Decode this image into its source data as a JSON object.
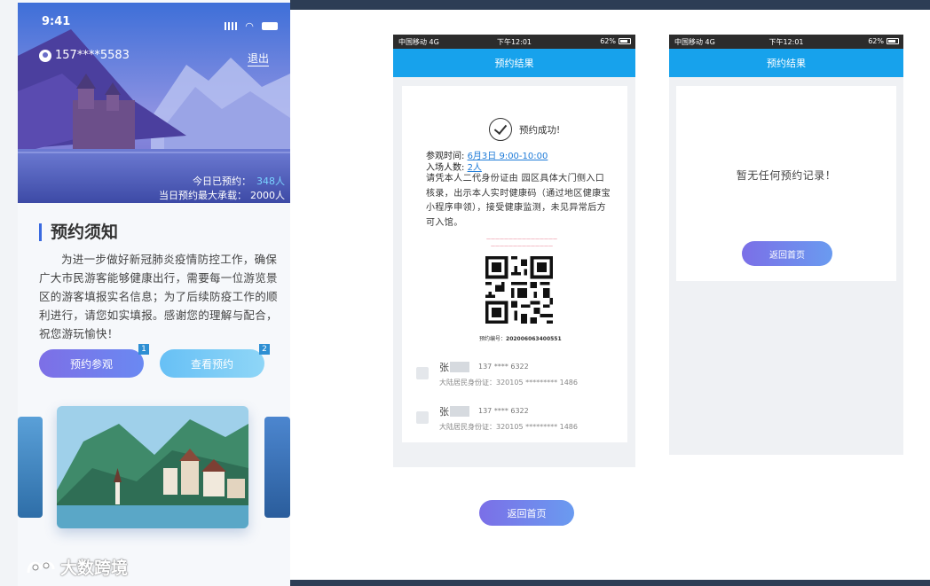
{
  "colors": {
    "accent_purple": "#7b6fe7",
    "accent_light_blue": "#67c0f5",
    "header_blue": "#17a2ec",
    "frame_dark": "#2d3d55",
    "link_blue": "#1e7bd8",
    "notice_red": "#e4566f"
  },
  "screen1": {
    "status": {
      "time": "9:41"
    },
    "user": {
      "phone": "157****5583",
      "icon": "user-icon"
    },
    "logout_label": "退出",
    "stats": {
      "today_label": "今日已预约：",
      "today_value": "348人",
      "max_label": "当日预约最大承载：",
      "max_value": "2000人"
    },
    "notice": {
      "title": "预约须知",
      "body": "为进一步做好新冠肺炎疫情防控工作，确保广大市民游客能够健康出行，需要每一位游览景区的游客填报实名信息；为了后续防疫工作的顺利进行，请您如实填报。感谢您的理解与配合，祝您游玩愉快！"
    },
    "buttons": {
      "book_label": "预约参观",
      "book_badge": "1",
      "view_label": "查看预约",
      "view_badge": "2"
    }
  },
  "screen2": {
    "status": {
      "carrier": "中国移动",
      "network": "4G",
      "time": "下午12:01",
      "battery": "62%"
    },
    "header_title": "预约结果",
    "success_text": "预约成功!",
    "visit_time_label": "参观时间:",
    "visit_time_value": "6月3日  9:00-10:00",
    "visitors_label": "入场人数:",
    "visitors_value": "2人",
    "instructions": "请凭本人二代身份证由   园区具体大门侧入口核录，出示本人实时健康码（通过地区健康宝小程序申领），接受健康监测，未见异常后方可入馆。",
    "reservation_no_label": "预约编号：",
    "reservation_no": "202006063400551",
    "visitors": [
      {
        "name": "张",
        "phone": "137 **** 6322",
        "id": "大陆居民身份证：320105 ********* 1486"
      },
      {
        "name": "张",
        "phone": "137 **** 6322",
        "id": "大陆居民身份证：320105 ********* 1486"
      }
    ],
    "return_label": "返回首页"
  },
  "screen3": {
    "status": {
      "carrier": "中国移动",
      "network": "4G",
      "time": "下午12:01",
      "battery": "62%"
    },
    "header_title": "预约结果",
    "empty_text": "暂无任何预约记录！",
    "return_label": "返回首页"
  },
  "watermark": {
    "text": "大数跨境"
  }
}
